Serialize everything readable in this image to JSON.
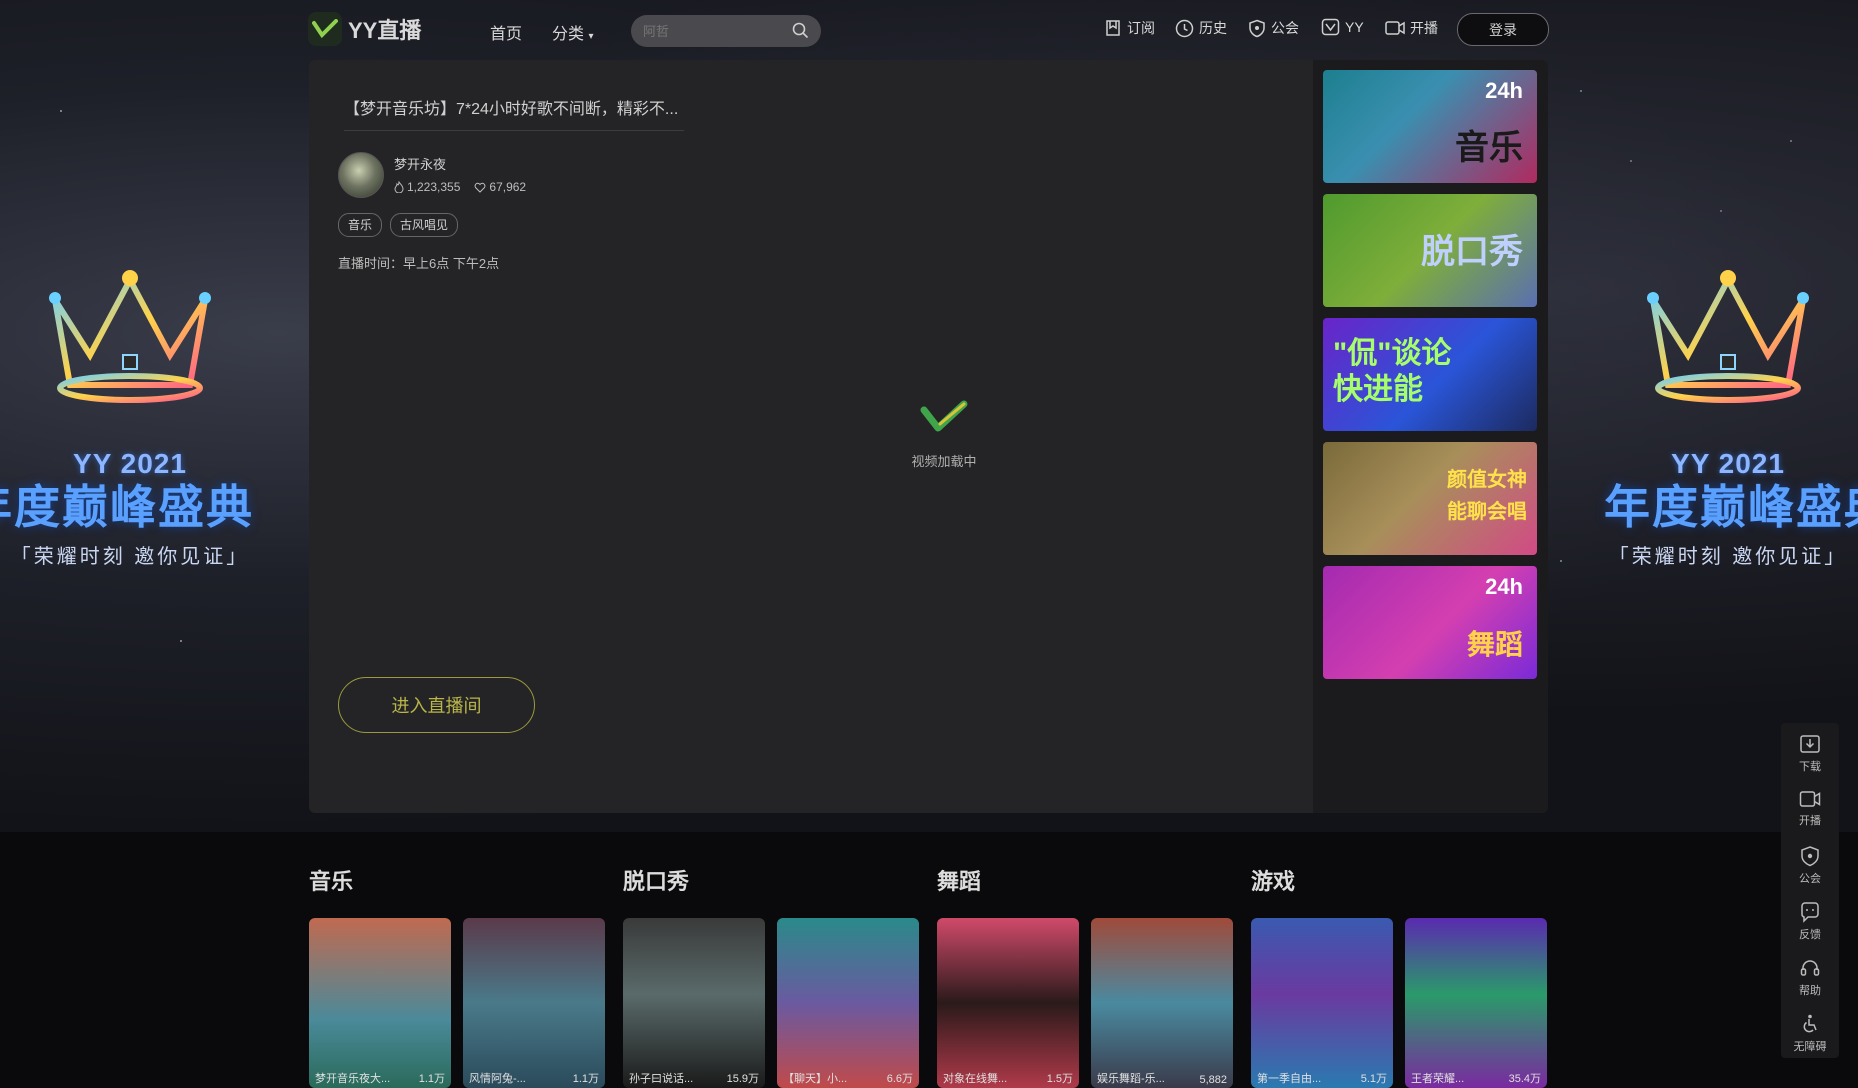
{
  "header": {
    "logo_text": "YY直播",
    "nav_home": "首页",
    "nav_category": "分类",
    "search_placeholder": "阿哲",
    "subscribe": "订阅",
    "history": "历史",
    "guild": "公会",
    "yy": "YY",
    "start_live": "开播",
    "login": "登录"
  },
  "banner": {
    "yy_year": "YY 2021",
    "event_name": "年度巅峰盛典",
    "slogan": "「荣耀时刻 邀你见证」"
  },
  "room": {
    "title": "【梦开音乐坊】7*24小时好歌不间断，精彩不...",
    "anchor_name": "梦开永夜",
    "viewers": "1,223,355",
    "likes": "67,962",
    "tags": [
      "音乐",
      "古风唱见"
    ],
    "schedule": "直播时间：早上6点 下午2点",
    "loading_text": "视频加载中",
    "enter_button": "进入直播间"
  },
  "side_thumbs": [
    {
      "label": "音乐",
      "badge": "24h"
    },
    {
      "label": "脱口秀",
      "badge": ""
    },
    {
      "label": "\"侃\"谈论 快进能",
      "badge": ""
    },
    {
      "label": "颜值女神 能聊会唱",
      "badge": ""
    },
    {
      "label": "舞蹈",
      "badge": "24h"
    }
  ],
  "categories": [
    {
      "title": "音乐",
      "cards": [
        {
          "name": "梦开音乐夜大...",
          "count": "1.1万"
        },
        {
          "name": "风情阿兔-...",
          "count": "1.1万"
        }
      ]
    },
    {
      "title": "脱口秀",
      "cards": [
        {
          "name": "孙子曰说话...",
          "count": "15.9万"
        },
        {
          "name": "【聊天】小...",
          "count": "6.6万"
        }
      ]
    },
    {
      "title": "舞蹈",
      "cards": [
        {
          "name": "对象在线舞...",
          "count": "1.5万"
        },
        {
          "name": "娱乐舞蹈-乐...",
          "count": "5,882"
        }
      ]
    },
    {
      "title": "游戏",
      "cards": [
        {
          "name": "第一季自由...",
          "count": "5.1万"
        },
        {
          "name": "王者荣耀...",
          "count": "35.4万"
        }
      ]
    }
  ],
  "toolbar": {
    "download": "下载",
    "start_live": "开播",
    "guild": "公会",
    "feedback": "反馈",
    "help": "帮助",
    "accessibility": "无障碍"
  },
  "colors": {
    "enter_button": "#b9b548",
    "panel": "#242426",
    "page_bg": "#0a0a0c"
  }
}
